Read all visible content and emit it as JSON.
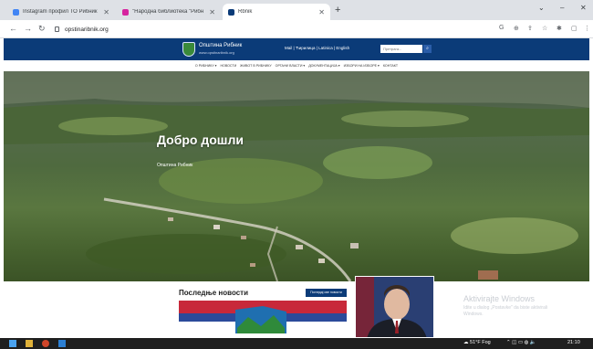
{
  "browser": {
    "tabs": [
      {
        "title": "Instagram профил ТО Рибник",
        "active": false
      },
      {
        "title": "\"Народна библиотека \"Рибн",
        "active": false
      },
      {
        "title": "Rbnik",
        "active": true
      }
    ],
    "url": "opstinaribnik.org"
  },
  "site": {
    "header": {
      "title": "Општина Рибник",
      "subtitle": "www.opstinaribnik.org",
      "links": "Mail  |  Ћирилица | Latinica | English",
      "search_placeholder": "Претрага..."
    },
    "nav": [
      "О Рибнику ▾",
      "Новости",
      "Живот в Рибнику",
      "Органи власти ▾",
      "Документација ▾",
      "Избори на изборе ▾",
      "Контакт"
    ],
    "hero": {
      "title": "Добро дошли",
      "subtitle": "Општина Рибник"
    },
    "news": {
      "title": "Последње новости",
      "button": "Погледај све новости"
    }
  },
  "windows": {
    "activation_title": "Aktivirajte Windows",
    "activation_sub_1": "Idite u dialog „Postavke\" da biste aktivirali",
    "activation_sub_2": "Windows.",
    "weather": "51°F Fog",
    "time": "21:10"
  },
  "colors": {
    "site_blue": "#0b3b78",
    "taskbar": "#1f1f1f"
  }
}
